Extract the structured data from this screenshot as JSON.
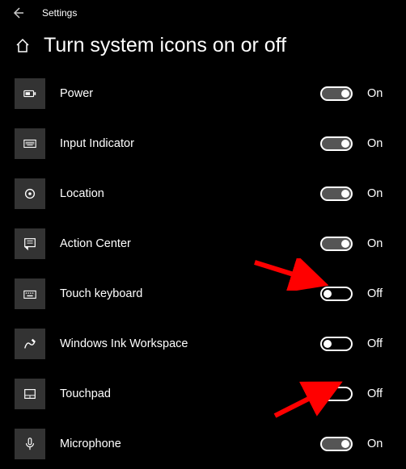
{
  "titlebar": {
    "app_name": "Settings"
  },
  "header": {
    "title": "Turn system icons on or off"
  },
  "items": [
    {
      "label": "Power",
      "on": true,
      "icon": "power-icon"
    },
    {
      "label": "Input Indicator",
      "on": true,
      "icon": "keyboard-icon"
    },
    {
      "label": "Location",
      "on": true,
      "icon": "location-icon"
    },
    {
      "label": "Action Center",
      "on": true,
      "icon": "action-center-icon"
    },
    {
      "label": "Touch keyboard",
      "on": false,
      "icon": "touch-keyboard-icon"
    },
    {
      "label": "Windows Ink Workspace",
      "on": false,
      "icon": "ink-icon"
    },
    {
      "label": "Touchpad",
      "on": false,
      "icon": "touchpad-icon"
    },
    {
      "label": "Microphone",
      "on": true,
      "icon": "microphone-icon"
    }
  ],
  "states": {
    "on": "On",
    "off": "Off"
  }
}
